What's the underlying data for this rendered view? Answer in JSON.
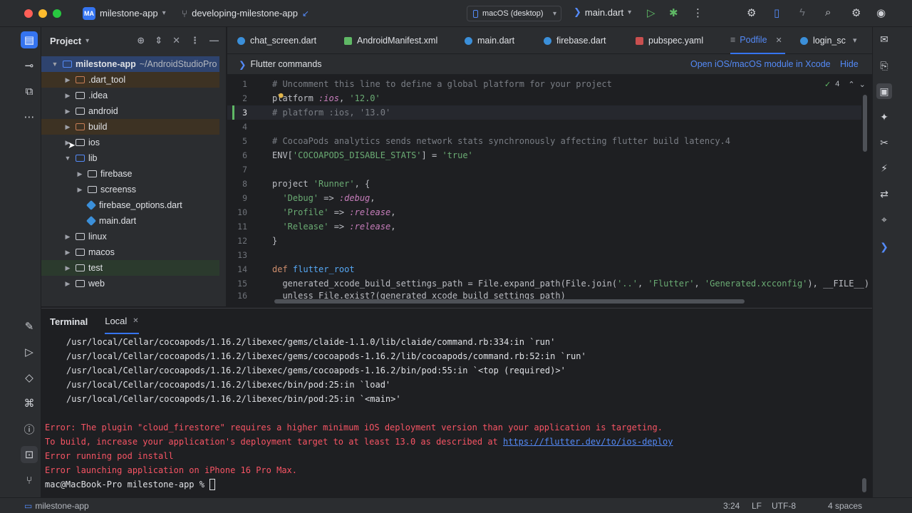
{
  "titlebar": {
    "project_badge": "MA",
    "project_name": "milestone-app",
    "branch": "developing-milestone-app",
    "device": "macOS (desktop)",
    "run_config": "main.dart"
  },
  "project_panel": {
    "title": "Project",
    "root_name": "milestone-app",
    "root_path": "~/AndroidStudioPro",
    "items": [
      {
        "label": ".dart_tool"
      },
      {
        "label": ".idea"
      },
      {
        "label": "android"
      },
      {
        "label": "build"
      },
      {
        "label": "ios"
      },
      {
        "label": "lib"
      },
      {
        "label": "firebase"
      },
      {
        "label": "screenss"
      },
      {
        "label": "firebase_options.dart"
      },
      {
        "label": "main.dart"
      },
      {
        "label": "linux"
      },
      {
        "label": "macos"
      },
      {
        "label": "test"
      },
      {
        "label": "web"
      }
    ]
  },
  "editor": {
    "tabs": [
      {
        "label": "chat_screen.dart"
      },
      {
        "label": "AndroidManifest.xml"
      },
      {
        "label": "main.dart"
      },
      {
        "label": "firebase.dart"
      },
      {
        "label": "pubspec.yaml"
      },
      {
        "label": "Podfile"
      },
      {
        "label": "login_sc"
      }
    ],
    "notice": {
      "title": "Flutter commands",
      "open_link": "Open iOS/macOS module in Xcode",
      "hide": "Hide"
    },
    "inspections_count": "4",
    "line_numbers": [
      "1",
      "2",
      "3",
      "4",
      "5",
      "6",
      "7",
      "8",
      "9",
      "10",
      "11",
      "12",
      "13",
      "14",
      "15",
      "16"
    ],
    "code": {
      "l1": "# Uncomment this line to define a global platform for your project",
      "l2a": "platform ",
      "l2b": ":ios",
      "l2c": ", ",
      "l2d": "'12.0'",
      "l3": "# platform :ios, '13.0'",
      "l5": "# CocoaPods analytics sends network stats synchronously affecting flutter build latency.4",
      "l6a": "ENV[",
      "l6b": "'COCOAPODS_DISABLE_STATS'",
      "l6c": "] = ",
      "l6d": "'true'",
      "l8a": "project ",
      "l8b": "'Runner'",
      "l8c": ", {",
      "l9a": "  ",
      "l9b": "'Debug'",
      "l9c": " => ",
      "l9d": ":debug",
      "l9e": ",",
      "l10b": "'Profile'",
      "l10d": ":release",
      "l11b": "'Release'",
      "l11d": ":release",
      "l12": "}",
      "l14a": "def ",
      "l14b": "flutter_root",
      "l15a": "  generated_xcode_build_settings_path = File.expand_path(File.join(",
      "l15b": "'..'",
      "l15c": ", ",
      "l15d": "'Flutter'",
      "l15e": ", ",
      "l15f": "'Generated.xcconfig'",
      "l15g": "), __FILE__)",
      "l16": "  unless File.exist?(generated_xcode_build_settings_path)"
    }
  },
  "terminal": {
    "title": "Terminal",
    "tab": "Local",
    "lines": [
      "/usr/local/Cellar/cocoapods/1.16.2/libexec/gems/claide-1.1.0/lib/claide/command.rb:334:in `run'",
      "/usr/local/Cellar/cocoapods/1.16.2/libexec/gems/cocoapods-1.16.2/lib/cocoapods/command.rb:52:in `run'",
      "/usr/local/Cellar/cocoapods/1.16.2/libexec/gems/cocoapods-1.16.2/bin/pod:55:in `<top (required)>'",
      "/usr/local/Cellar/cocoapods/1.16.2/libexec/bin/pod:25:in `load'",
      "/usr/local/Cellar/cocoapods/1.16.2/libexec/bin/pod:25:in `<main>'"
    ],
    "errors": {
      "e1": "Error: The plugin \"cloud_firestore\" requires a higher minimum iOS deployment version than your application is targeting.",
      "e2": "To build, increase your application's deployment target to at least 13.0 as described at ",
      "e2_link": "https://flutter.dev/to/ios-deploy",
      "e3": "Error running pod install",
      "e4": "Error launching application on iPhone 16 Pro Max."
    },
    "prompt": "mac@MacBook-Pro milestone-app % "
  },
  "statusbar": {
    "project": "milestone-app",
    "position": "3:24",
    "line_sep": "LF",
    "encoding": "UTF-8",
    "indent": "4 spaces"
  },
  "colors": {
    "accent": "#3574f0",
    "error": "#f75464",
    "string": "#6aab73",
    "comment": "#7a7e85"
  }
}
